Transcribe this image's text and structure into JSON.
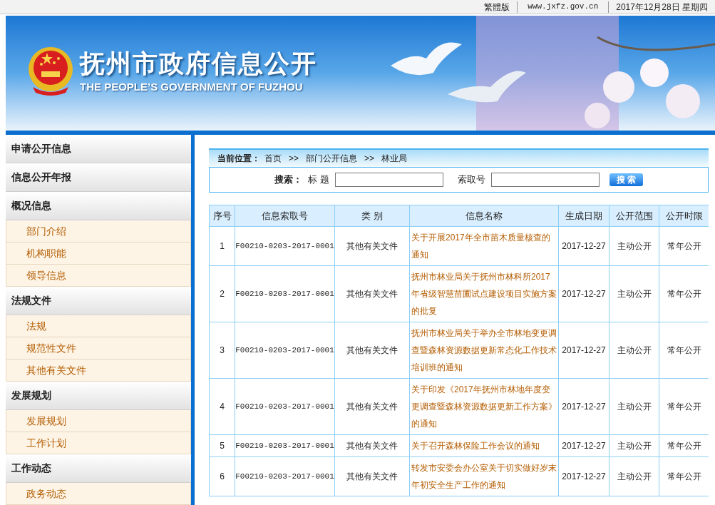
{
  "top_bar": {
    "links": [
      "繁體版",
      "www.jxfz.gov.cn",
      "2017年12月28日 星期四"
    ]
  },
  "banner": {
    "title": "抚州市政府信息公开",
    "subtitle": "THE PEOPLE’S GOVERNMENT OF FUZHOU"
  },
  "sidebar": {
    "sections": [
      {
        "title": "申请公开信息"
      },
      {
        "title": "信息公开年报"
      },
      {
        "title": "概况信息",
        "items": [
          "部门介绍",
          "机构职能",
          "领导信息"
        ]
      },
      {
        "title": "法规文件",
        "items": [
          "法规",
          "规范性文件",
          "其他有关文件"
        ]
      },
      {
        "title": "发展规划",
        "items": [
          "发展规划",
          "工作计划"
        ]
      },
      {
        "title": "工作动态",
        "items": [
          "政务动态"
        ]
      }
    ]
  },
  "breadcrumb": {
    "label": "当前位置：",
    "path": [
      "首页",
      "部门公开信息",
      "林业局"
    ],
    "separator": ">>"
  },
  "search": {
    "label": "搜索：",
    "title_label": "标 题",
    "index_label": "索取号",
    "button": "搜 索"
  },
  "table": {
    "columns": [
      "序号",
      "信息索取号",
      "类 别",
      "信息名称",
      "生成日期",
      "公开范围",
      "公开时限"
    ],
    "rows": [
      [
        "1",
        "F00210-0203-2017-0001",
        "其他有关文件",
        "关于开展2017年全市苗木质量核查的通知",
        "2017-12-27",
        "主动公开",
        "常年公开"
      ],
      [
        "2",
        "F00210-0203-2017-0001",
        "其他有关文件",
        "抚州市林业局关于抚州市林科所2017年省级智慧苗圃试点建设项目实施方案的批复",
        "2017-12-27",
        "主动公开",
        "常年公开"
      ],
      [
        "3",
        "F00210-0203-2017-0001",
        "其他有关文件",
        "抚州市林业局关于举办全市林地变更调查暨森林资源数据更新常态化工作技术培训班的通知",
        "2017-12-27",
        "主动公开",
        "常年公开"
      ],
      [
        "4",
        "F00210-0203-2017-0001",
        "其他有关文件",
        "关于印发《2017年抚州市林地年度变更调查暨森林资源数据更新工作方案》的通知",
        "2017-12-27",
        "主动公开",
        "常年公开"
      ],
      [
        "5",
        "F00210-0203-2017-0001",
        "其他有关文件",
        "关于召开森林保险工作会议的通知",
        "2017-12-27",
        "主动公开",
        "常年公开"
      ],
      [
        "6",
        "F00210-0203-2017-0001",
        "其他有关文件",
        "转发市安委会办公室关于切实做好岁末年初安全生产工作的通知",
        "2017-12-27",
        "主动公开",
        "常年公开"
      ]
    ]
  }
}
